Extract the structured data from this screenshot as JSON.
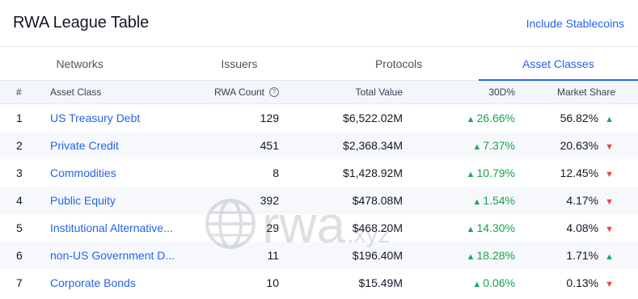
{
  "header": {
    "title": "RWA League Table",
    "link_label": "Include Stablecoins"
  },
  "tabs": [
    {
      "label": "Networks",
      "active": false
    },
    {
      "label": "Issuers",
      "active": false
    },
    {
      "label": "Protocols",
      "active": false
    },
    {
      "label": "Asset Classes",
      "active": true
    }
  ],
  "table": {
    "headers": {
      "num": "#",
      "asset_class": "Asset Class",
      "rwa_count": "RWA Count",
      "total_value": "Total Value",
      "d30": "30D%",
      "market_share": "Market Share"
    },
    "rows": [
      {
        "num": "1",
        "asset_class": "US Treasury Debt",
        "rwa_count": "129",
        "total_value": "$6,522.02M",
        "d30": "26.66%",
        "market_share": "56.82%",
        "trend": "up"
      },
      {
        "num": "2",
        "asset_class": "Private Credit",
        "rwa_count": "451",
        "total_value": "$2,368.34M",
        "d30": "7.37%",
        "market_share": "20.63%",
        "trend": "down"
      },
      {
        "num": "3",
        "asset_class": "Commodities",
        "rwa_count": "8",
        "total_value": "$1,428.92M",
        "d30": "10.79%",
        "market_share": "12.45%",
        "trend": "down"
      },
      {
        "num": "4",
        "asset_class": "Public Equity",
        "rwa_count": "392",
        "total_value": "$478.08M",
        "d30": "1.54%",
        "market_share": "4.17%",
        "trend": "down"
      },
      {
        "num": "5",
        "asset_class": "Institutional Alternative...",
        "rwa_count": "29",
        "total_value": "$468.20M",
        "d30": "14.30%",
        "market_share": "4.08%",
        "trend": "down"
      },
      {
        "num": "6",
        "asset_class": "non-US Government D...",
        "rwa_count": "11",
        "total_value": "$196.40M",
        "d30": "18.28%",
        "market_share": "1.71%",
        "trend": "up"
      },
      {
        "num": "7",
        "asset_class": "Corporate Bonds",
        "rwa_count": "10",
        "total_value": "$15.49M",
        "d30": "0.06%",
        "market_share": "0.13%",
        "trend": "down"
      }
    ]
  },
  "watermark": {
    "text": "rwa",
    "suffix": ".xyz"
  },
  "colors": {
    "accent": "#2563eb",
    "positive": "#16a34a",
    "negative": "#ef4444"
  },
  "icons": {
    "help": "question-circle-icon",
    "up": "triangle-up-icon",
    "down": "triangle-down-icon",
    "watermark": "globe-icon"
  }
}
